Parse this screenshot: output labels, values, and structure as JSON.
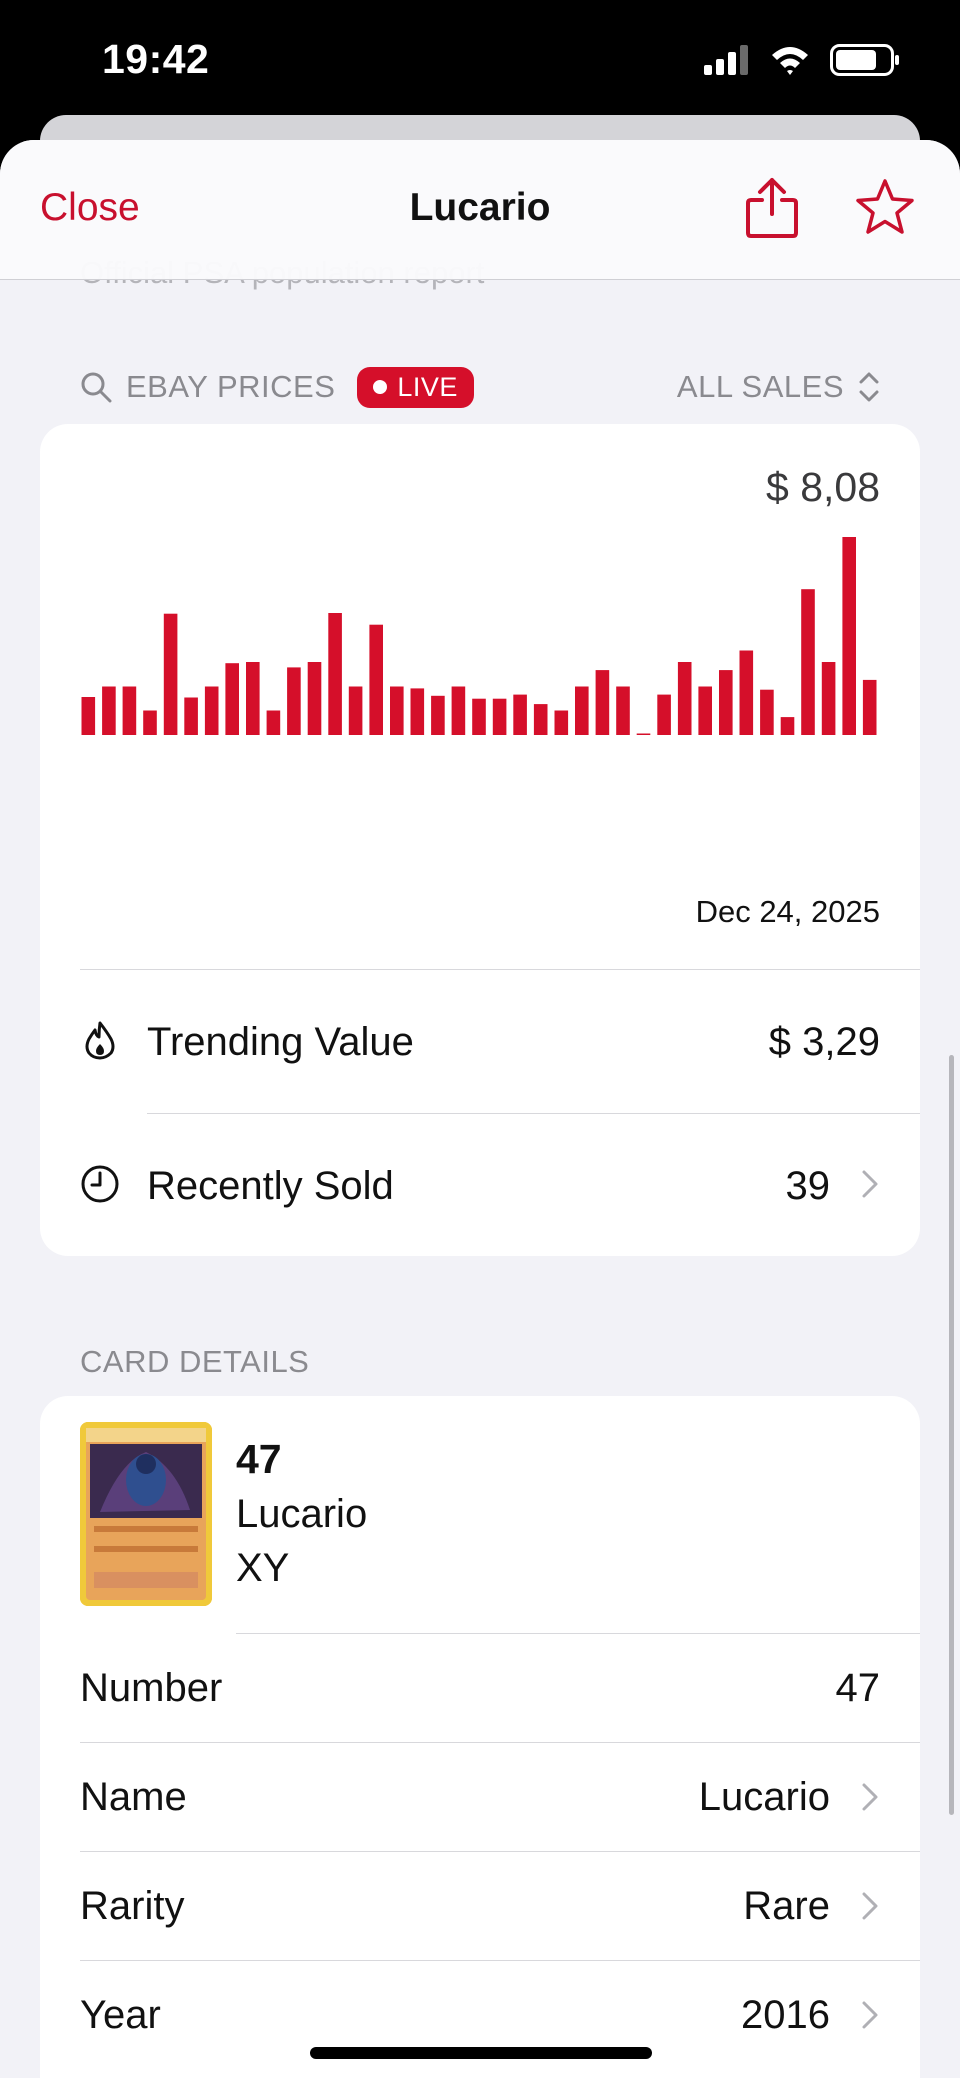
{
  "status_bar": {
    "time": "19:42"
  },
  "nav": {
    "close_label": "Close",
    "title": "Lucario",
    "share_icon": "share-icon",
    "favorite_icon": "star-icon",
    "accent_color": "#c8102e"
  },
  "faded_text": "Official PSA population report",
  "ebay_section": {
    "header": "EBAY PRICES",
    "live_badge": "LIVE",
    "filter_label": "ALL SALES",
    "chart": {
      "price_label": "$ 8,08",
      "date_label": "Dec 24, 2025",
      "bar_color": "#d50f2a"
    },
    "trending_label": "Trending Value",
    "trending_value": "$ 3,29",
    "recent_label": "Recently Sold",
    "recent_value": "39"
  },
  "chart_data": {
    "type": "bar",
    "values": [
      1.55,
      1.98,
      1.98,
      1.0,
      4.95,
      1.53,
      1.98,
      2.93,
      2.98,
      1.0,
      2.76,
      2.98,
      4.98,
      1.98,
      4.5,
      1.98,
      1.9,
      1.6,
      1.98,
      1.48,
      1.48,
      1.65,
      1.26,
      1.0,
      1.98,
      2.65,
      1.98,
      0.02,
      1.65,
      2.98,
      1.98,
      2.65,
      3.45,
      1.85,
      0.73,
      5.95,
      2.98,
      8.08,
      2.25
    ],
    "ylim": [
      0,
      8.08
    ],
    "grid": false,
    "legend": "none"
  },
  "card_details": {
    "header": "CARD DETAILS",
    "card_number": "47",
    "card_name": "Lucario",
    "card_set": "XY",
    "rows": [
      {
        "label": "Number",
        "value": "47"
      },
      {
        "label": "Name",
        "value": "Lucario"
      },
      {
        "label": "Rarity",
        "value": "Rare"
      },
      {
        "label": "Year",
        "value": "2016"
      }
    ]
  }
}
